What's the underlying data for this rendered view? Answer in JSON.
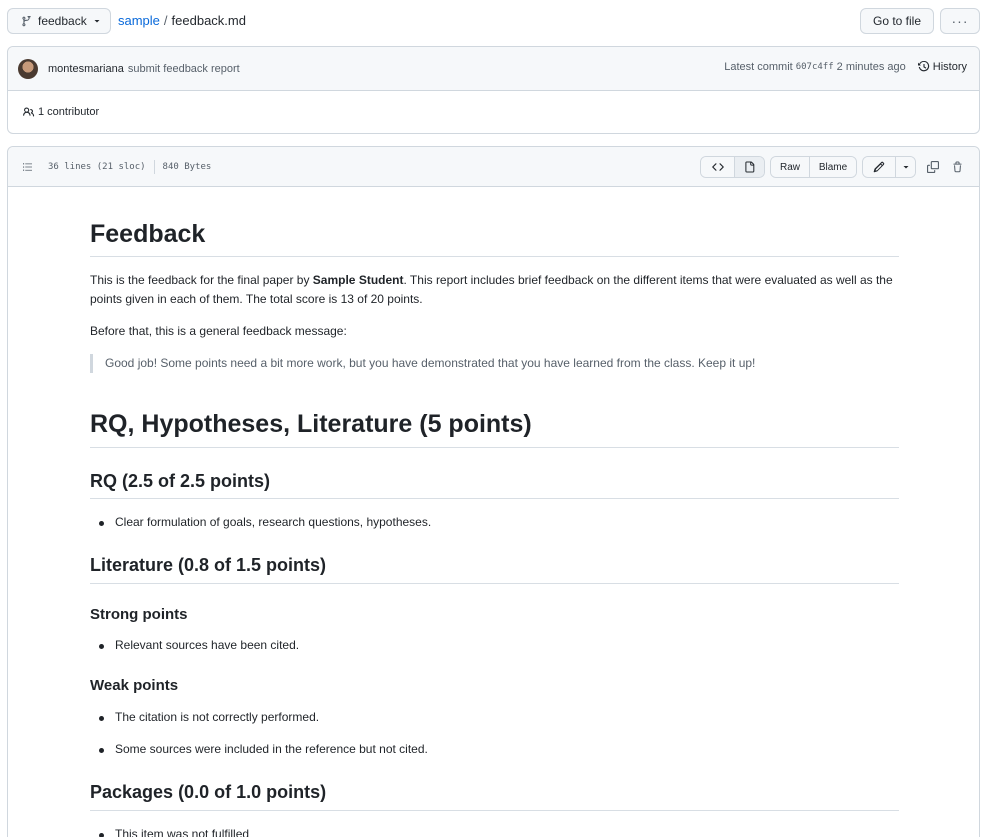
{
  "topbar": {
    "branch": "feedback",
    "repo": "sample",
    "separator": "/",
    "file": "feedback.md",
    "go_to_file": "Go to file",
    "more": "···"
  },
  "commit": {
    "author": "montesmariana",
    "message": "submit feedback report",
    "latest_label": "Latest commit",
    "sha": "607c4ff",
    "time": "2 minutes ago",
    "history": "History",
    "contributors": "1 contributor"
  },
  "file_header": {
    "lines": "36 lines (21 sloc)",
    "size": "840 Bytes",
    "raw": "Raw",
    "blame": "Blame"
  },
  "doc": {
    "h1": "Feedback",
    "intro_pre": "This is the feedback for the final paper by ",
    "intro_bold": "Sample Student",
    "intro_post": ". This report includes brief feedback on the different items that were evaluated as well as the points given in each of them. The total score is 13 of 20 points.",
    "before": "Before that, this is a general feedback message:",
    "quote": "Good job! Some points need a bit more work, but you have demonstrated that you have learned from the class. Keep it up!",
    "section1": "RQ, Hypotheses, Literature (5 points)",
    "rq_heading": "RQ (2.5 of 2.5 points)",
    "rq_items": [
      "Clear formulation of goals, research questions, hypotheses."
    ],
    "lit_heading": "Literature (0.8 of 1.5 points)",
    "strong_heading": "Strong points",
    "strong_items": [
      "Relevant sources have been cited."
    ],
    "weak_heading": "Weak points",
    "weak_items": [
      "The citation is not correctly performed.",
      "Some sources were included in the reference but not cited."
    ],
    "pkg_heading": "Packages (0.0 of 1.0 points)",
    "pkg_items": [
      "This item was not fulfilled"
    ]
  }
}
